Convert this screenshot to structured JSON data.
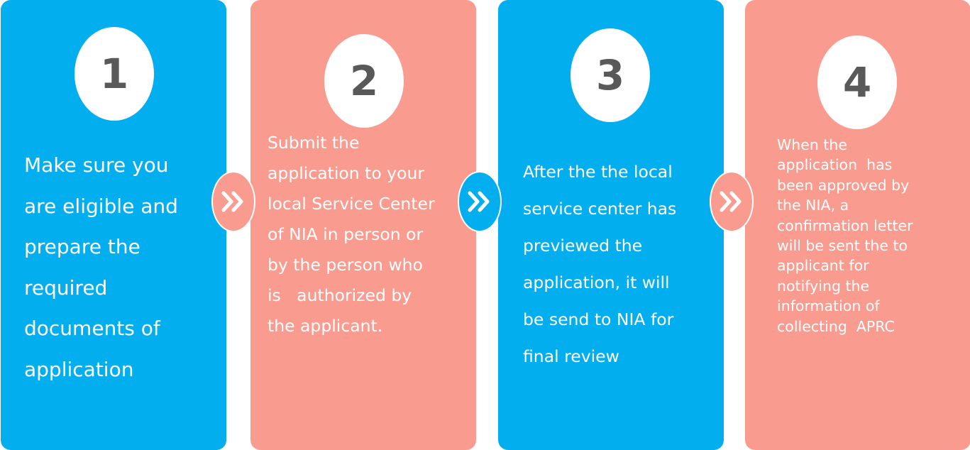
{
  "steps": [
    {
      "number": "1",
      "color": "#03aeef",
      "lines": [
        "Make sure you",
        "are  eligible and",
        "prepare the",
        "required",
        "documents of",
        "application"
      ]
    },
    {
      "number": "2",
      "color": "#fa9b8f",
      "lines": [
        "Submit the",
        "application to your",
        "local Service Center",
        "of NIA in person or",
        "by the person who",
        "is   authorized by",
        "the applicant."
      ]
    },
    {
      "number": "3",
      "color": "#03aeef",
      "lines": [
        "After the the local",
        "service center has",
        "previewed the",
        "application, it will",
        "be send to NIA for",
        "final review"
      ]
    },
    {
      "number": "4",
      "color": "#fa9b8f",
      "lines": [
        "When the",
        "application  has",
        "been approved by",
        "the NIA, a",
        "confirmation letter",
        "will be sent the to",
        "applicant for",
        "notifying the",
        "information of",
        "collecting  APRC"
      ]
    }
  ],
  "connectors": [
    {
      "icon": "double-chevron-right-icon",
      "color": "#fa9b8f"
    },
    {
      "icon": "double-chevron-right-icon",
      "color": "#03aeef"
    },
    {
      "icon": "double-chevron-right-icon",
      "color": "#fa9b8f"
    }
  ]
}
